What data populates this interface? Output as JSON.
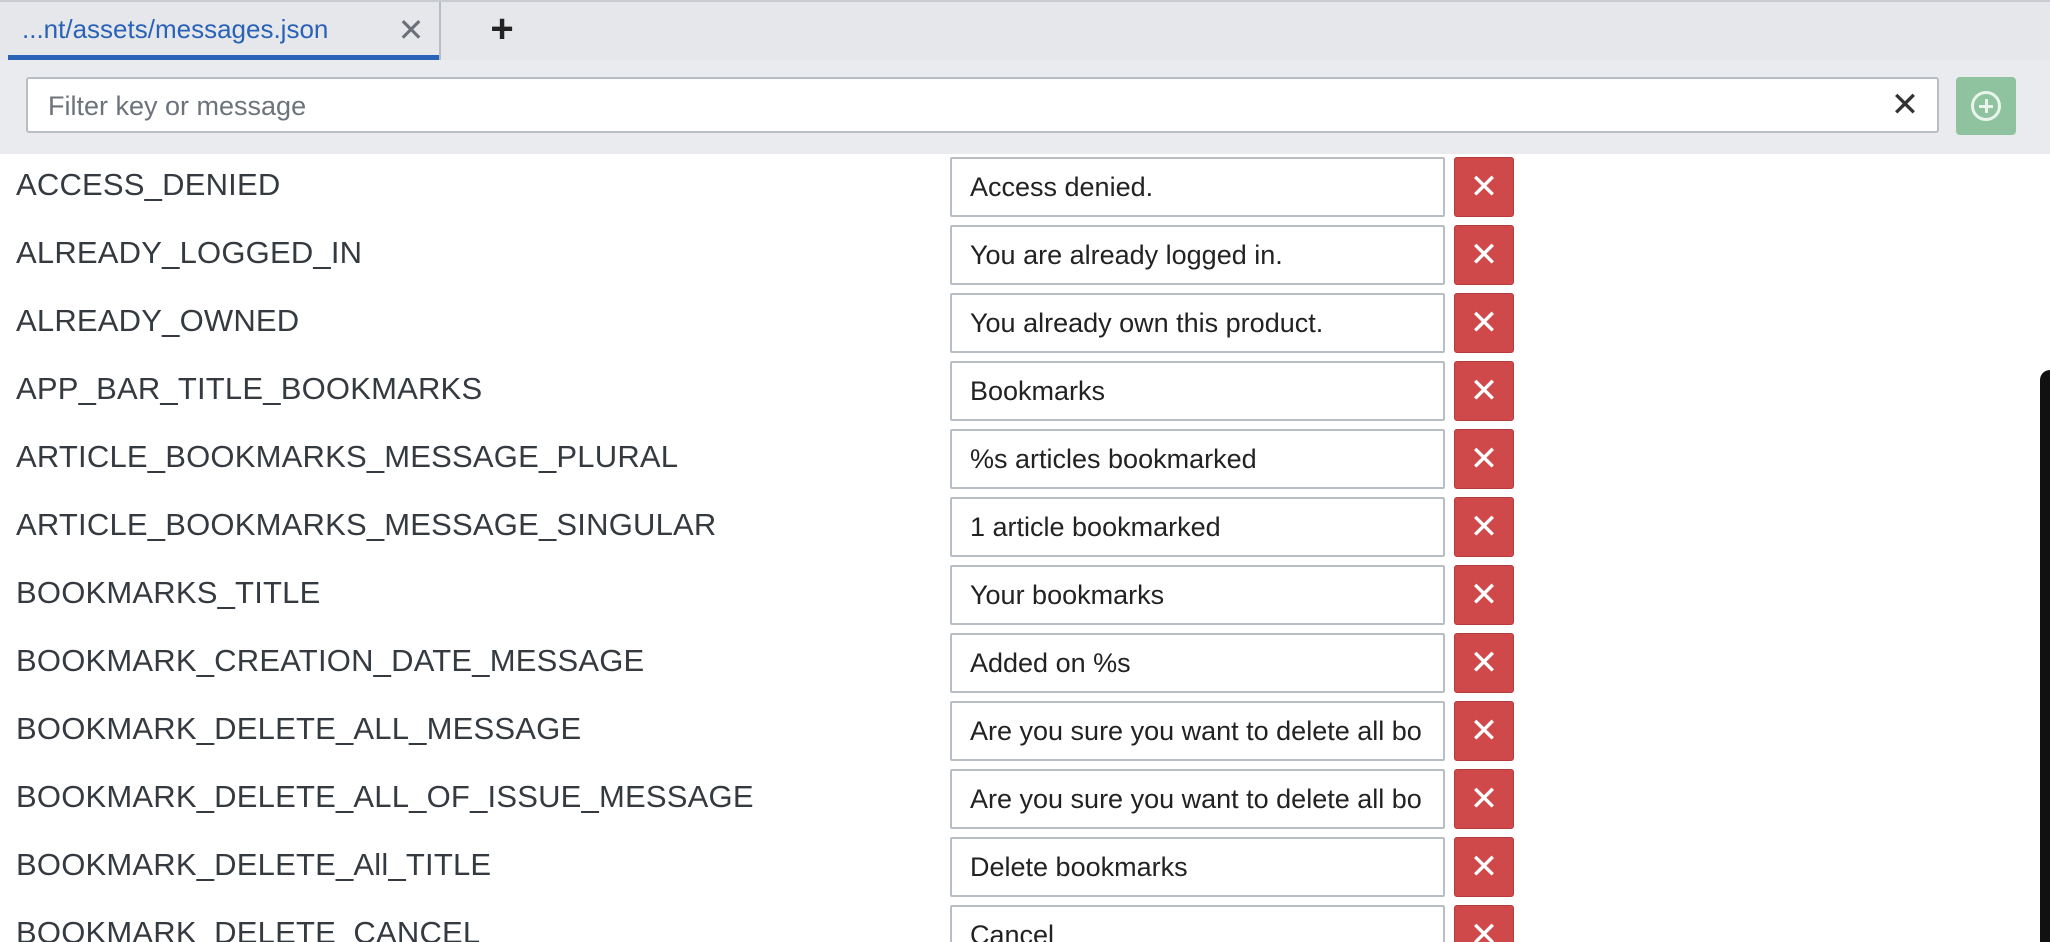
{
  "tabs": [
    {
      "label": "...nt/assets/messages.json",
      "close_glyph": "✕"
    }
  ],
  "tab_add_glyph": "+",
  "filter": {
    "placeholder": "Filter key or message",
    "value": "",
    "clear_glyph": "✕"
  },
  "colors": {
    "accent": "#2a62b8",
    "delete": "#d0494a",
    "add": "#8fc3a0"
  },
  "icons": {
    "tab_close": "close-icon",
    "tab_add": "plus-icon",
    "filter_clear": "clear-icon",
    "add": "plus-circle-icon",
    "row_delete": "close-icon"
  },
  "delete_glyph": "✕",
  "messages": [
    {
      "key": "ACCESS_DENIED",
      "value": "Access denied."
    },
    {
      "key": "ALREADY_LOGGED_IN",
      "value": "You are already logged in."
    },
    {
      "key": "ALREADY_OWNED",
      "value": "You already own this product."
    },
    {
      "key": "APP_BAR_TITLE_BOOKMARKS",
      "value": "Bookmarks"
    },
    {
      "key": "ARTICLE_BOOKMARKS_MESSAGE_PLURAL",
      "value": "%s articles bookmarked"
    },
    {
      "key": "ARTICLE_BOOKMARKS_MESSAGE_SINGULAR",
      "value": "1 article bookmarked"
    },
    {
      "key": "BOOKMARKS_TITLE",
      "value": "Your bookmarks"
    },
    {
      "key": "BOOKMARK_CREATION_DATE_MESSAGE",
      "value": "Added on %s"
    },
    {
      "key": "BOOKMARK_DELETE_ALL_MESSAGE",
      "value": "Are you sure you want to delete all bo"
    },
    {
      "key": "BOOKMARK_DELETE_ALL_OF_ISSUE_MESSAGE",
      "value": "Are you sure you want to delete all bo"
    },
    {
      "key": "BOOKMARK_DELETE_All_TITLE",
      "value": "Delete bookmarks"
    },
    {
      "key": "BOOKMARK_DELETE_CANCEL",
      "value": "Cancel"
    }
  ]
}
